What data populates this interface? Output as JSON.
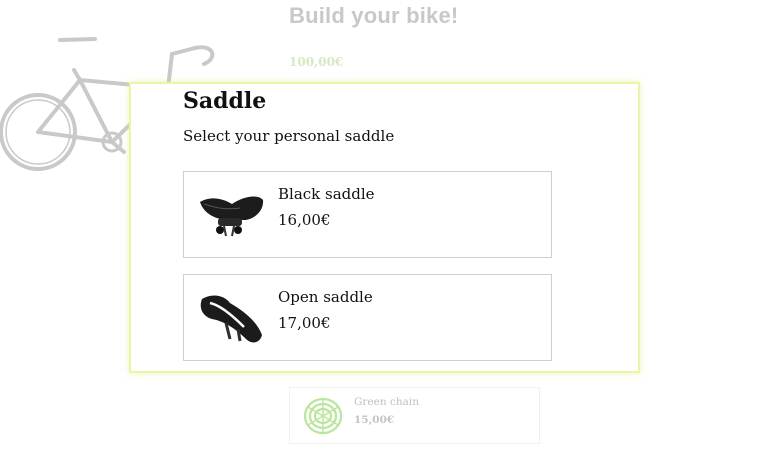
{
  "page": {
    "title": "Build your bike!",
    "base_price": "100,00€"
  },
  "modal": {
    "title": "Saddle",
    "subtitle": "Select your personal saddle",
    "options": [
      {
        "name": "Black saddle",
        "price": "16,00€",
        "icon": "black-saddle"
      },
      {
        "name": "Open saddle",
        "price": "17,00€",
        "icon": "open-saddle"
      }
    ]
  },
  "background_components": [
    {
      "name": "Green chain",
      "price": "15,00€",
      "icon": "green-chain"
    }
  ],
  "colors": {
    "modal_border": "#eef3a6",
    "price_green_faded": "#d6e8c2",
    "chain_green": "#b9e59c"
  }
}
